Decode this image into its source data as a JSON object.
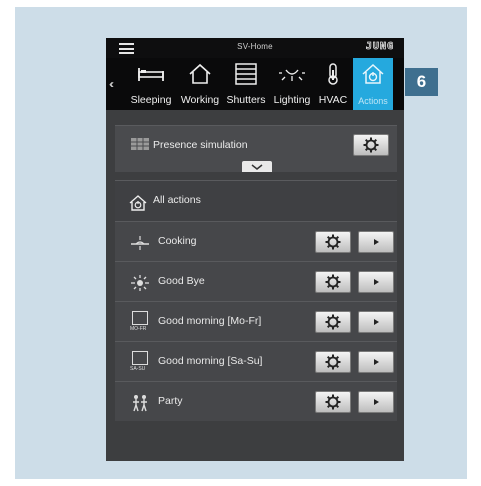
{
  "topbar": {
    "title": "SV-Home",
    "brand": "JUNG"
  },
  "categories": [
    {
      "label": "Sleeping",
      "icon": "bed-icon",
      "active": false
    },
    {
      "label": "Working",
      "icon": "house-icon",
      "active": false
    },
    {
      "label": "Shutters",
      "icon": "shutter-icon",
      "active": false
    },
    {
      "label": "Lighting",
      "icon": "light-icon",
      "active": false
    },
    {
      "label": "HVAC",
      "icon": "thermometer-icon",
      "active": false
    },
    {
      "label": "Actions",
      "icon": "actions-house-icon",
      "active": true
    }
  ],
  "presence": {
    "title": "Presence simulation"
  },
  "all_actions": {
    "title": "All actions"
  },
  "actions": [
    {
      "label": "Cooking",
      "icon": "cooking-icon"
    },
    {
      "label": "Good Bye",
      "icon": "sun-icon"
    },
    {
      "label": "Good morning [Mo-Fr]",
      "icon": "calendar-mofr-icon",
      "icon_text": "MO-FR"
    },
    {
      "label": "Good morning [Sa-Su]",
      "icon": "calendar-sasu-icon",
      "icon_text": "SA-SU"
    },
    {
      "label": "Party",
      "icon": "party-icon"
    }
  ],
  "callout": "6",
  "colors": {
    "accent": "#25a9de",
    "frame": "#cddde8",
    "callout": "#3f6f8f"
  }
}
